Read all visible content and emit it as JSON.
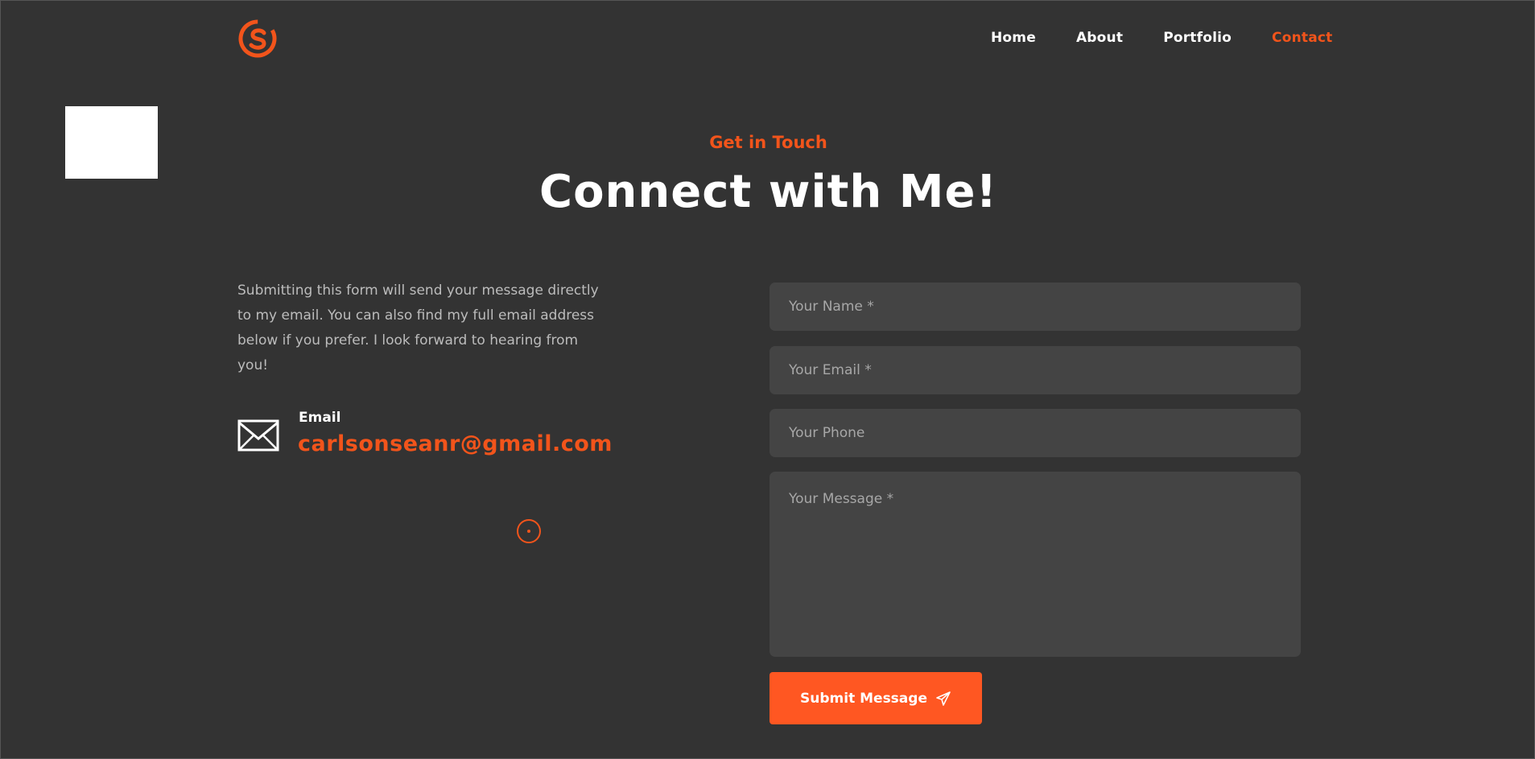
{
  "colors": {
    "background": "#333333",
    "accent": "#f2541b",
    "button": "#ff5722",
    "field": "#444444"
  },
  "header": {
    "logo_icon": "cs-monogram-logo",
    "nav": [
      {
        "label": "Home",
        "active": false
      },
      {
        "label": "About",
        "active": false
      },
      {
        "label": "Portfolio",
        "active": false
      },
      {
        "label": "Contact",
        "active": true
      }
    ]
  },
  "hero": {
    "eyebrow": "Get in Touch",
    "title": "Connect with Me!"
  },
  "contact_info": {
    "intro": "Submitting this form will send your message directly to my email. You can also find my full email address below if you prefer. I look forward to hearing from you!",
    "email_icon": "envelope-icon",
    "email_label": "Email",
    "email_value": "carlsonseanr@gmail.com"
  },
  "form": {
    "name_placeholder": "Your Name *",
    "email_placeholder": "Your Email *",
    "phone_placeholder": "Your Phone",
    "message_placeholder": "Your Message *",
    "submit_label": "Submit Message",
    "submit_icon": "paper-plane-icon"
  }
}
